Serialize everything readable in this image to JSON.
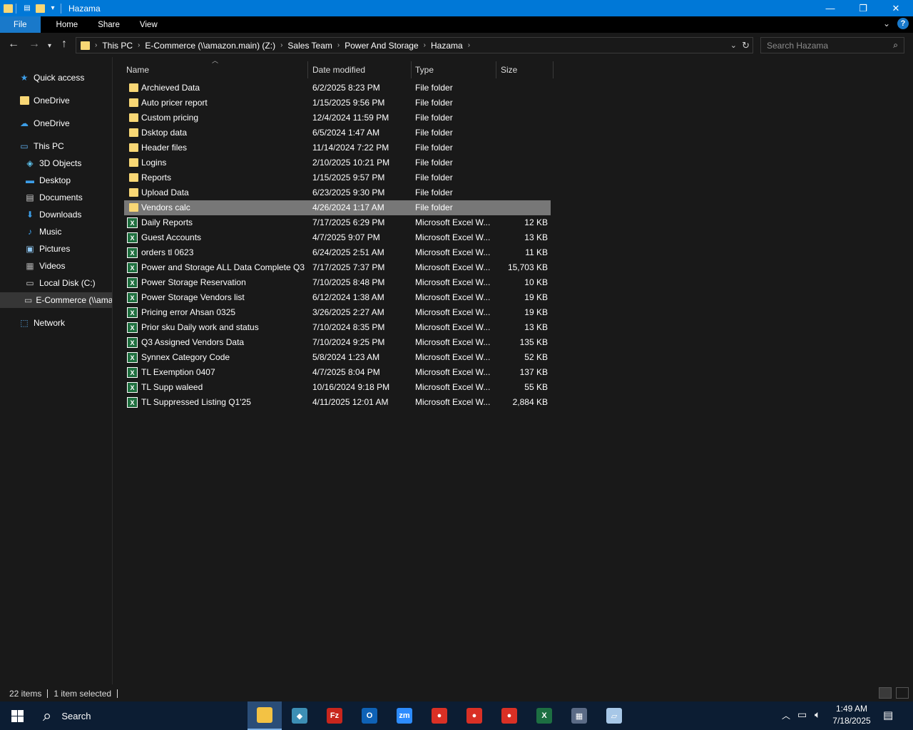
{
  "window": {
    "title": "Hazama"
  },
  "ribbon": {
    "tabs": [
      "File",
      "Home",
      "Share",
      "View"
    ]
  },
  "address": {
    "crumbs": [
      "This PC",
      "E-Commerce (\\\\amazon.main) (Z:)",
      "Sales Team",
      "Power And Storage",
      "Hazama"
    ],
    "search_placeholder": "Search Hazama"
  },
  "sidebar": {
    "items": [
      {
        "label": "Quick access",
        "icon": "star-icon"
      },
      {
        "label": "OneDrive",
        "icon": "folder-icon"
      },
      {
        "label": "OneDrive",
        "icon": "cloud-icon"
      },
      {
        "label": "This PC",
        "icon": "computer-icon"
      },
      {
        "label": "3D Objects",
        "icon": "cube-icon"
      },
      {
        "label": "Desktop",
        "icon": "desktop-icon"
      },
      {
        "label": "Documents",
        "icon": "document-icon"
      },
      {
        "label": "Downloads",
        "icon": "download-icon"
      },
      {
        "label": "Music",
        "icon": "music-icon"
      },
      {
        "label": "Pictures",
        "icon": "pictures-icon"
      },
      {
        "label": "Videos",
        "icon": "video-icon"
      },
      {
        "label": "Local Disk (C:)",
        "icon": "drive-icon"
      },
      {
        "label": "E-Commerce (\\\\amazon.main) (Z:)",
        "icon": "network-drive-icon"
      },
      {
        "label": "Network",
        "icon": "network-icon"
      }
    ]
  },
  "columns": {
    "name": "Name",
    "date": "Date modified",
    "type": "Type",
    "size": "Size"
  },
  "files": [
    {
      "name": "Archieved Data",
      "date": "6/2/2025 8:23 PM",
      "type": "File folder",
      "size": "",
      "kind": "folder"
    },
    {
      "name": "Auto pricer report",
      "date": "1/15/2025 9:56 PM",
      "type": "File folder",
      "size": "",
      "kind": "folder"
    },
    {
      "name": "Custom pricing",
      "date": "12/4/2024 11:59 PM",
      "type": "File folder",
      "size": "",
      "kind": "folder"
    },
    {
      "name": "Dsktop data",
      "date": "6/5/2024 1:47 AM",
      "type": "File folder",
      "size": "",
      "kind": "folder"
    },
    {
      "name": "Header files",
      "date": "11/14/2024 7:22 PM",
      "type": "File folder",
      "size": "",
      "kind": "folder"
    },
    {
      "name": "Logins",
      "date": "2/10/2025 10:21 PM",
      "type": "File folder",
      "size": "",
      "kind": "folder"
    },
    {
      "name": "Reports",
      "date": "1/15/2025 9:57 PM",
      "type": "File folder",
      "size": "",
      "kind": "folder"
    },
    {
      "name": "Upload Data",
      "date": "6/23/2025 9:30 PM",
      "type": "File folder",
      "size": "",
      "kind": "folder"
    },
    {
      "name": "Vendors calc",
      "date": "4/26/2024 1:17 AM",
      "type": "File folder",
      "size": "",
      "kind": "folder",
      "selected": true
    },
    {
      "name": "Daily Reports",
      "date": "7/17/2025 6:29 PM",
      "type": "Microsoft Excel W...",
      "size": "12 KB",
      "kind": "excel"
    },
    {
      "name": "Guest Accounts",
      "date": "4/7/2025 9:07 PM",
      "type": "Microsoft Excel W...",
      "size": "13 KB",
      "kind": "excel"
    },
    {
      "name": "orders tl 0623",
      "date": "6/24/2025 2:51 AM",
      "type": "Microsoft Excel W...",
      "size": "11 KB",
      "kind": "excel"
    },
    {
      "name": "Power and Storage ALL Data Complete Q3",
      "date": "7/17/2025 7:37 PM",
      "type": "Microsoft Excel W...",
      "size": "15,703 KB",
      "kind": "excel"
    },
    {
      "name": "Power Storage Reservation",
      "date": "7/10/2025 8:48 PM",
      "type": "Microsoft Excel W...",
      "size": "10 KB",
      "kind": "excel"
    },
    {
      "name": "Power Storage Vendors list",
      "date": "6/12/2024 1:38 AM",
      "type": "Microsoft Excel W...",
      "size": "19 KB",
      "kind": "excel"
    },
    {
      "name": "Pricing error Ahsan 0325",
      "date": "3/26/2025 2:27 AM",
      "type": "Microsoft Excel W...",
      "size": "19 KB",
      "kind": "excel"
    },
    {
      "name": "Prior sku Daily work and status",
      "date": "7/10/2024 8:35 PM",
      "type": "Microsoft Excel W...",
      "size": "13 KB",
      "kind": "excel"
    },
    {
      "name": "Q3 Assigned Vendors Data",
      "date": "7/10/2024 9:25 PM",
      "type": "Microsoft Excel W...",
      "size": "135 KB",
      "kind": "excel"
    },
    {
      "name": "Synnex Category Code",
      "date": "5/8/2024 1:23 AM",
      "type": "Microsoft Excel W...",
      "size": "52 KB",
      "kind": "excel"
    },
    {
      "name": "TL Exemption 0407",
      "date": "4/7/2025 8:04 PM",
      "type": "Microsoft Excel W...",
      "size": "137 KB",
      "kind": "excel"
    },
    {
      "name": "TL Supp waleed",
      "date": "10/16/2024 9:18 PM",
      "type": "Microsoft Excel W...",
      "size": "55 KB",
      "kind": "excel"
    },
    {
      "name": "TL Suppressed Listing Q1'25",
      "date": "4/11/2025 12:01 AM",
      "type": "Microsoft Excel W...",
      "size": "2,884 KB",
      "kind": "excel"
    }
  ],
  "status": {
    "count": "22 items",
    "selection": "1 item selected"
  },
  "taskbar": {
    "search_label": "Search",
    "time": "1:49 AM",
    "date": "7/18/2025",
    "apps": [
      {
        "name": "file-explorer-app",
        "color": "#f3c244",
        "glyph": "",
        "active": true
      },
      {
        "name": "app-icon",
        "color": "#3d8fb5",
        "glyph": "◆"
      },
      {
        "name": "filezilla-app",
        "color": "#c8261d",
        "glyph": "Fz"
      },
      {
        "name": "outlook-app",
        "color": "#0f62b6",
        "glyph": "O"
      },
      {
        "name": "zoom-app",
        "color": "#2d8cff",
        "glyph": "zm"
      },
      {
        "name": "chrome-app",
        "color": "#d93025",
        "glyph": "●"
      },
      {
        "name": "chrome-app-2",
        "color": "#d93025",
        "glyph": "●"
      },
      {
        "name": "chrome-app-3",
        "color": "#d93025",
        "glyph": "●"
      },
      {
        "name": "excel-app",
        "color": "#1d6f42",
        "glyph": "X"
      },
      {
        "name": "calculator-app",
        "color": "#5b6b86",
        "glyph": "▦"
      },
      {
        "name": "notes-app",
        "color": "#a7c7e7",
        "glyph": "▱"
      }
    ]
  },
  "colors": {
    "titlebar": "#0078d7",
    "selection": "#777777",
    "folder": "#f8d775",
    "excel": "#1f6f3f"
  }
}
